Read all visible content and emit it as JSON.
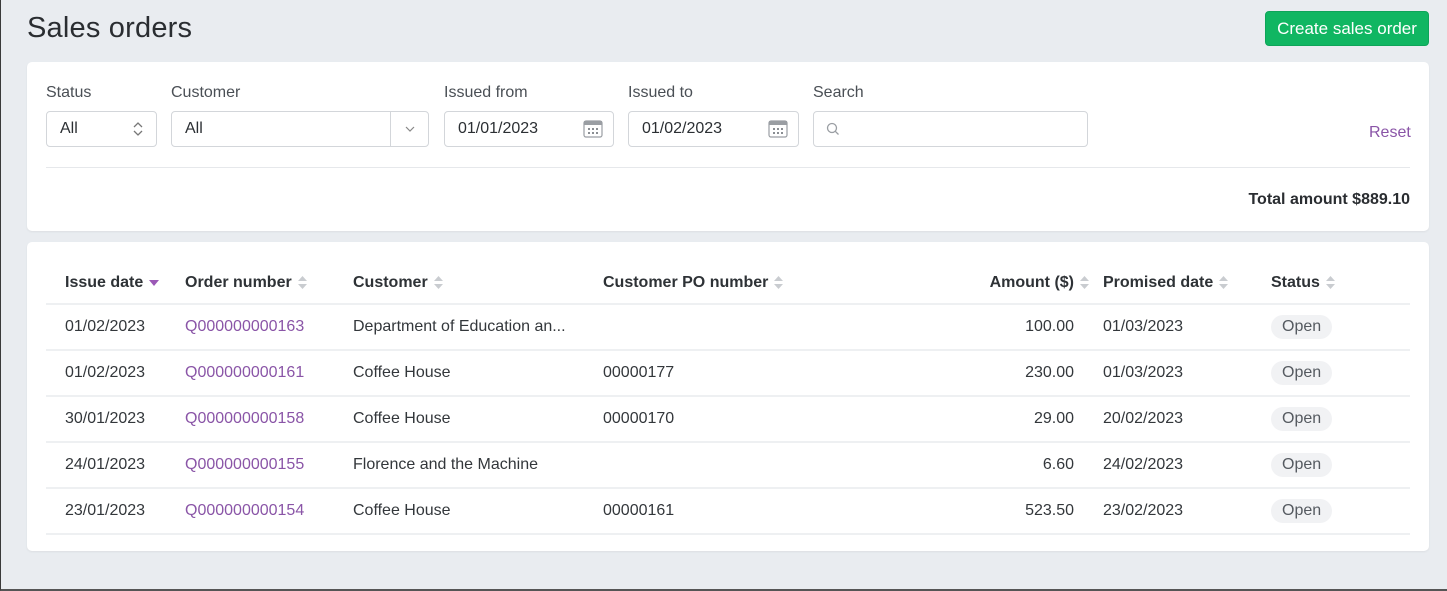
{
  "header": {
    "title": "Sales orders",
    "create_button": "Create sales order"
  },
  "filters": {
    "status": {
      "label": "Status",
      "value": "All"
    },
    "customer": {
      "label": "Customer",
      "value": "All"
    },
    "issued_from": {
      "label": "Issued from",
      "value": "01/01/2023"
    },
    "issued_to": {
      "label": "Issued to",
      "value": "01/02/2023"
    },
    "search": {
      "label": "Search",
      "value": "",
      "placeholder": ""
    },
    "reset_label": "Reset",
    "total_amount": "Total amount $889.10"
  },
  "table": {
    "columns": [
      {
        "label": "Issue date",
        "sort": "desc"
      },
      {
        "label": "Order number",
        "sort": "none"
      },
      {
        "label": "Customer",
        "sort": "none"
      },
      {
        "label": "Customer PO number",
        "sort": "none"
      },
      {
        "label": "Amount ($)",
        "sort": "none"
      },
      {
        "label": "Promised date",
        "sort": "none"
      },
      {
        "label": "Status",
        "sort": "none"
      }
    ],
    "rows": [
      {
        "issue_date": "01/02/2023",
        "order_number": "Q000000000163",
        "customer": "Department of Education an...",
        "po_number": "",
        "amount": "100.00",
        "promised_date": "01/03/2023",
        "status": "Open"
      },
      {
        "issue_date": "01/02/2023",
        "order_number": "Q000000000161",
        "customer": "Coffee House",
        "po_number": "00000177",
        "amount": "230.00",
        "promised_date": "01/03/2023",
        "status": "Open"
      },
      {
        "issue_date": "30/01/2023",
        "order_number": "Q000000000158",
        "customer": "Coffee House",
        "po_number": "00000170",
        "amount": "29.00",
        "promised_date": "20/02/2023",
        "status": "Open"
      },
      {
        "issue_date": "24/01/2023",
        "order_number": "Q000000000155",
        "customer": "Florence and the Machine",
        "po_number": "",
        "amount": "6.60",
        "promised_date": "24/02/2023",
        "status": "Open"
      },
      {
        "issue_date": "23/01/2023",
        "order_number": "Q000000000154",
        "customer": "Coffee House",
        "po_number": "00000161",
        "amount": "523.50",
        "promised_date": "23/02/2023",
        "status": "Open"
      }
    ]
  },
  "colors": {
    "primary_button": "#10b662",
    "link": "#8a55a7",
    "background": "#e9ecf0"
  }
}
